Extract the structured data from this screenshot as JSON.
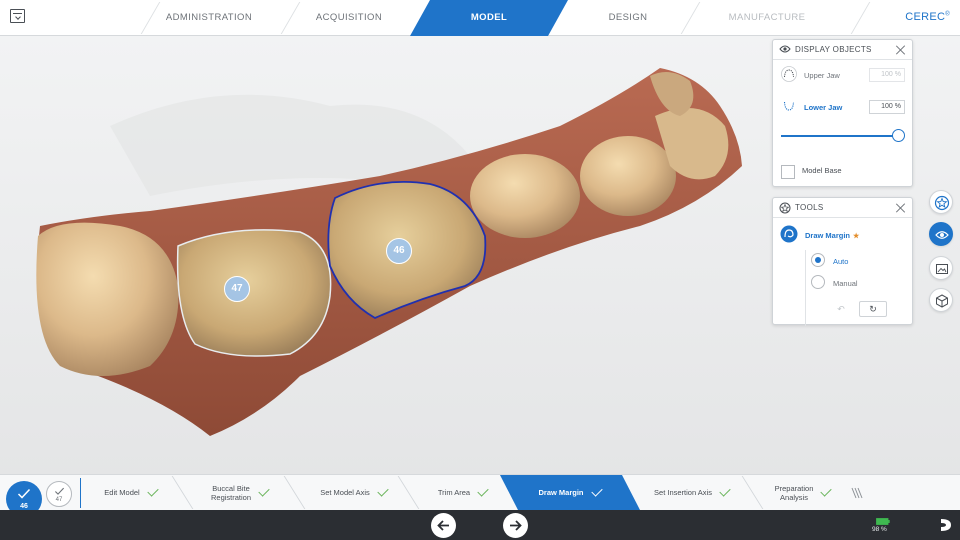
{
  "header": {
    "tabs": [
      {
        "label": "ADMINISTRATION",
        "state": "normal"
      },
      {
        "label": "ACQUISITION",
        "state": "normal"
      },
      {
        "label": "MODEL",
        "state": "active"
      },
      {
        "label": "DESIGN",
        "state": "normal"
      },
      {
        "label": "MANUFACTURE",
        "state": "disabled"
      }
    ],
    "brand": "CEREC",
    "brand_mark": "®"
  },
  "model": {
    "teeth_labels": [
      "47",
      "46"
    ]
  },
  "display_objects": {
    "title": "DISPLAY OBJECTS",
    "objects": [
      {
        "label": "Upper Jaw",
        "value": "100 %",
        "active": false
      },
      {
        "label": "Lower Jaw",
        "value": "100 %",
        "active": true
      }
    ],
    "opacity_fraction": 1.0,
    "model_base_label": "Model Base",
    "model_base_checked": false
  },
  "tools": {
    "title": "TOOLS",
    "tool_label": "Draw Margin",
    "tool_mark": "★",
    "modes": [
      {
        "label": "Auto",
        "selected": true
      },
      {
        "label": "Manual",
        "selected": false
      }
    ],
    "undo_icon": "↶",
    "reset_icon": "↻"
  },
  "right_rail": [
    {
      "icon": "tooth-star-icon",
      "state": "normal"
    },
    {
      "icon": "eye-icon",
      "state": "active"
    },
    {
      "icon": "image-icon",
      "state": "normal"
    },
    {
      "icon": "cube-icon",
      "state": "normal"
    }
  ],
  "workflow": {
    "teeth": [
      {
        "label": "46",
        "selected": true
      },
      {
        "label": "47",
        "selected": false
      }
    ],
    "steps": [
      {
        "label": "Edit Model",
        "done": true
      },
      {
        "label": "Buccal Bite\nRegistration",
        "done": true
      },
      {
        "label": "Set Model Axis",
        "done": true
      },
      {
        "label": "Trim Area",
        "done": true
      },
      {
        "label": "Draw Margin",
        "done": true,
        "active": true
      },
      {
        "label": "Set Insertion Axis",
        "done": true
      },
      {
        "label": "Preparation\nAnalysis",
        "done": true
      }
    ]
  },
  "statusbar": {
    "battery": "98 %",
    "battery_color": "#3fb950",
    "accent": "#1f74c9"
  }
}
